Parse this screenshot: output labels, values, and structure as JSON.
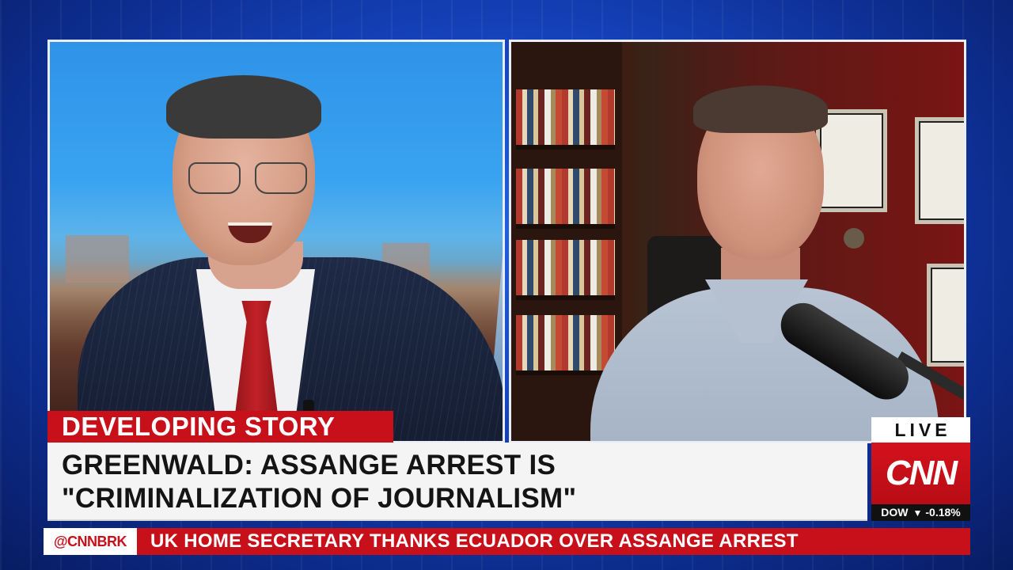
{
  "lower_third": {
    "tag": "DEVELOPING STORY",
    "headline_line_1": "GREENWALD: ASSANGE ARREST IS",
    "headline_line_2": "\"CRIMINALIZATION OF JOURNALISM\""
  },
  "network_bug": {
    "live_label": "LIVE",
    "logo_text": "CNN",
    "ticker_symbol": "DOW",
    "ticker_change": "-0.18%",
    "ticker_direction": "down"
  },
  "crawl": {
    "brand": "@CNNBRK",
    "text": "UK HOME SECRETARY THANKS ECUADOR OVER ASSANGE ARREST"
  },
  "colors": {
    "cnn_red": "#c8101a",
    "background_blue": "#1646c2",
    "headline_bg": "#f4f4f4"
  },
  "icons": {
    "ticker_arrow": "triangle-down-icon"
  }
}
